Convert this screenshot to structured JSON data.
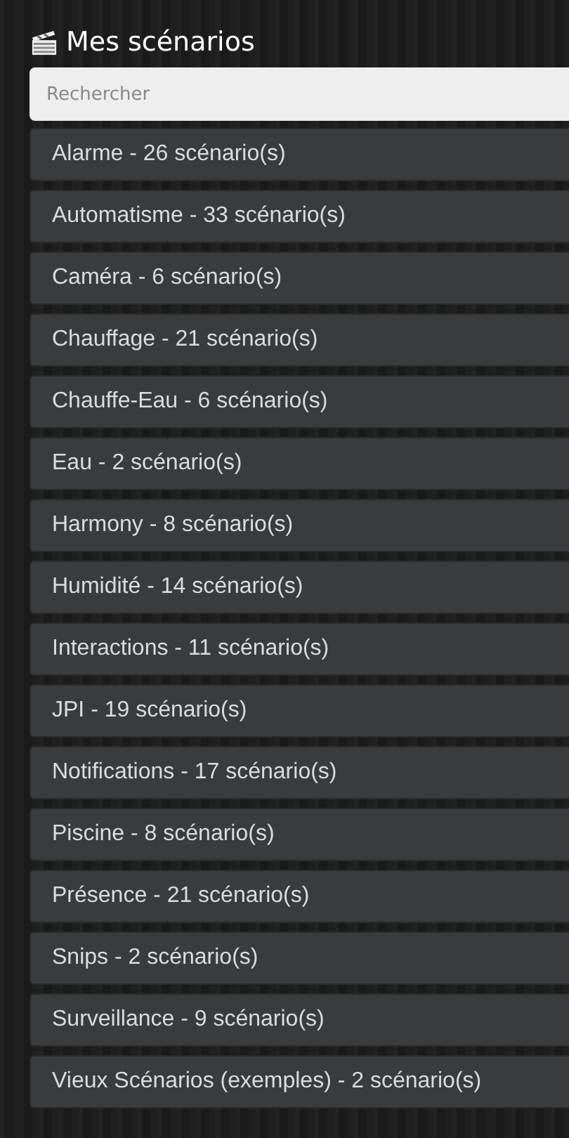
{
  "title": "Mes scénarios",
  "search": {
    "placeholder": "Rechercher"
  },
  "groups": [
    {
      "label": "Alarme - 26 scénario(s)"
    },
    {
      "label": "Automatisme - 33 scénario(s)"
    },
    {
      "label": "Caméra - 6 scénario(s)"
    },
    {
      "label": "Chauffage - 21 scénario(s)"
    },
    {
      "label": "Chauffe-Eau - 6 scénario(s)"
    },
    {
      "label": "Eau - 2 scénario(s)"
    },
    {
      "label": "Harmony - 8 scénario(s)"
    },
    {
      "label": "Humidité - 14 scénario(s)"
    },
    {
      "label": "Interactions - 11 scénario(s)"
    },
    {
      "label": "JPI - 19 scénario(s)"
    },
    {
      "label": "Notifications - 17 scénario(s)"
    },
    {
      "label": "Piscine - 8 scénario(s)"
    },
    {
      "label": "Présence - 21 scénario(s)"
    },
    {
      "label": "Snips - 2 scénario(s)"
    },
    {
      "label": "Surveillance - 9 scénario(s)"
    },
    {
      "label": "Vieux Scénarios (exemples) - 2 scénario(s)"
    }
  ]
}
